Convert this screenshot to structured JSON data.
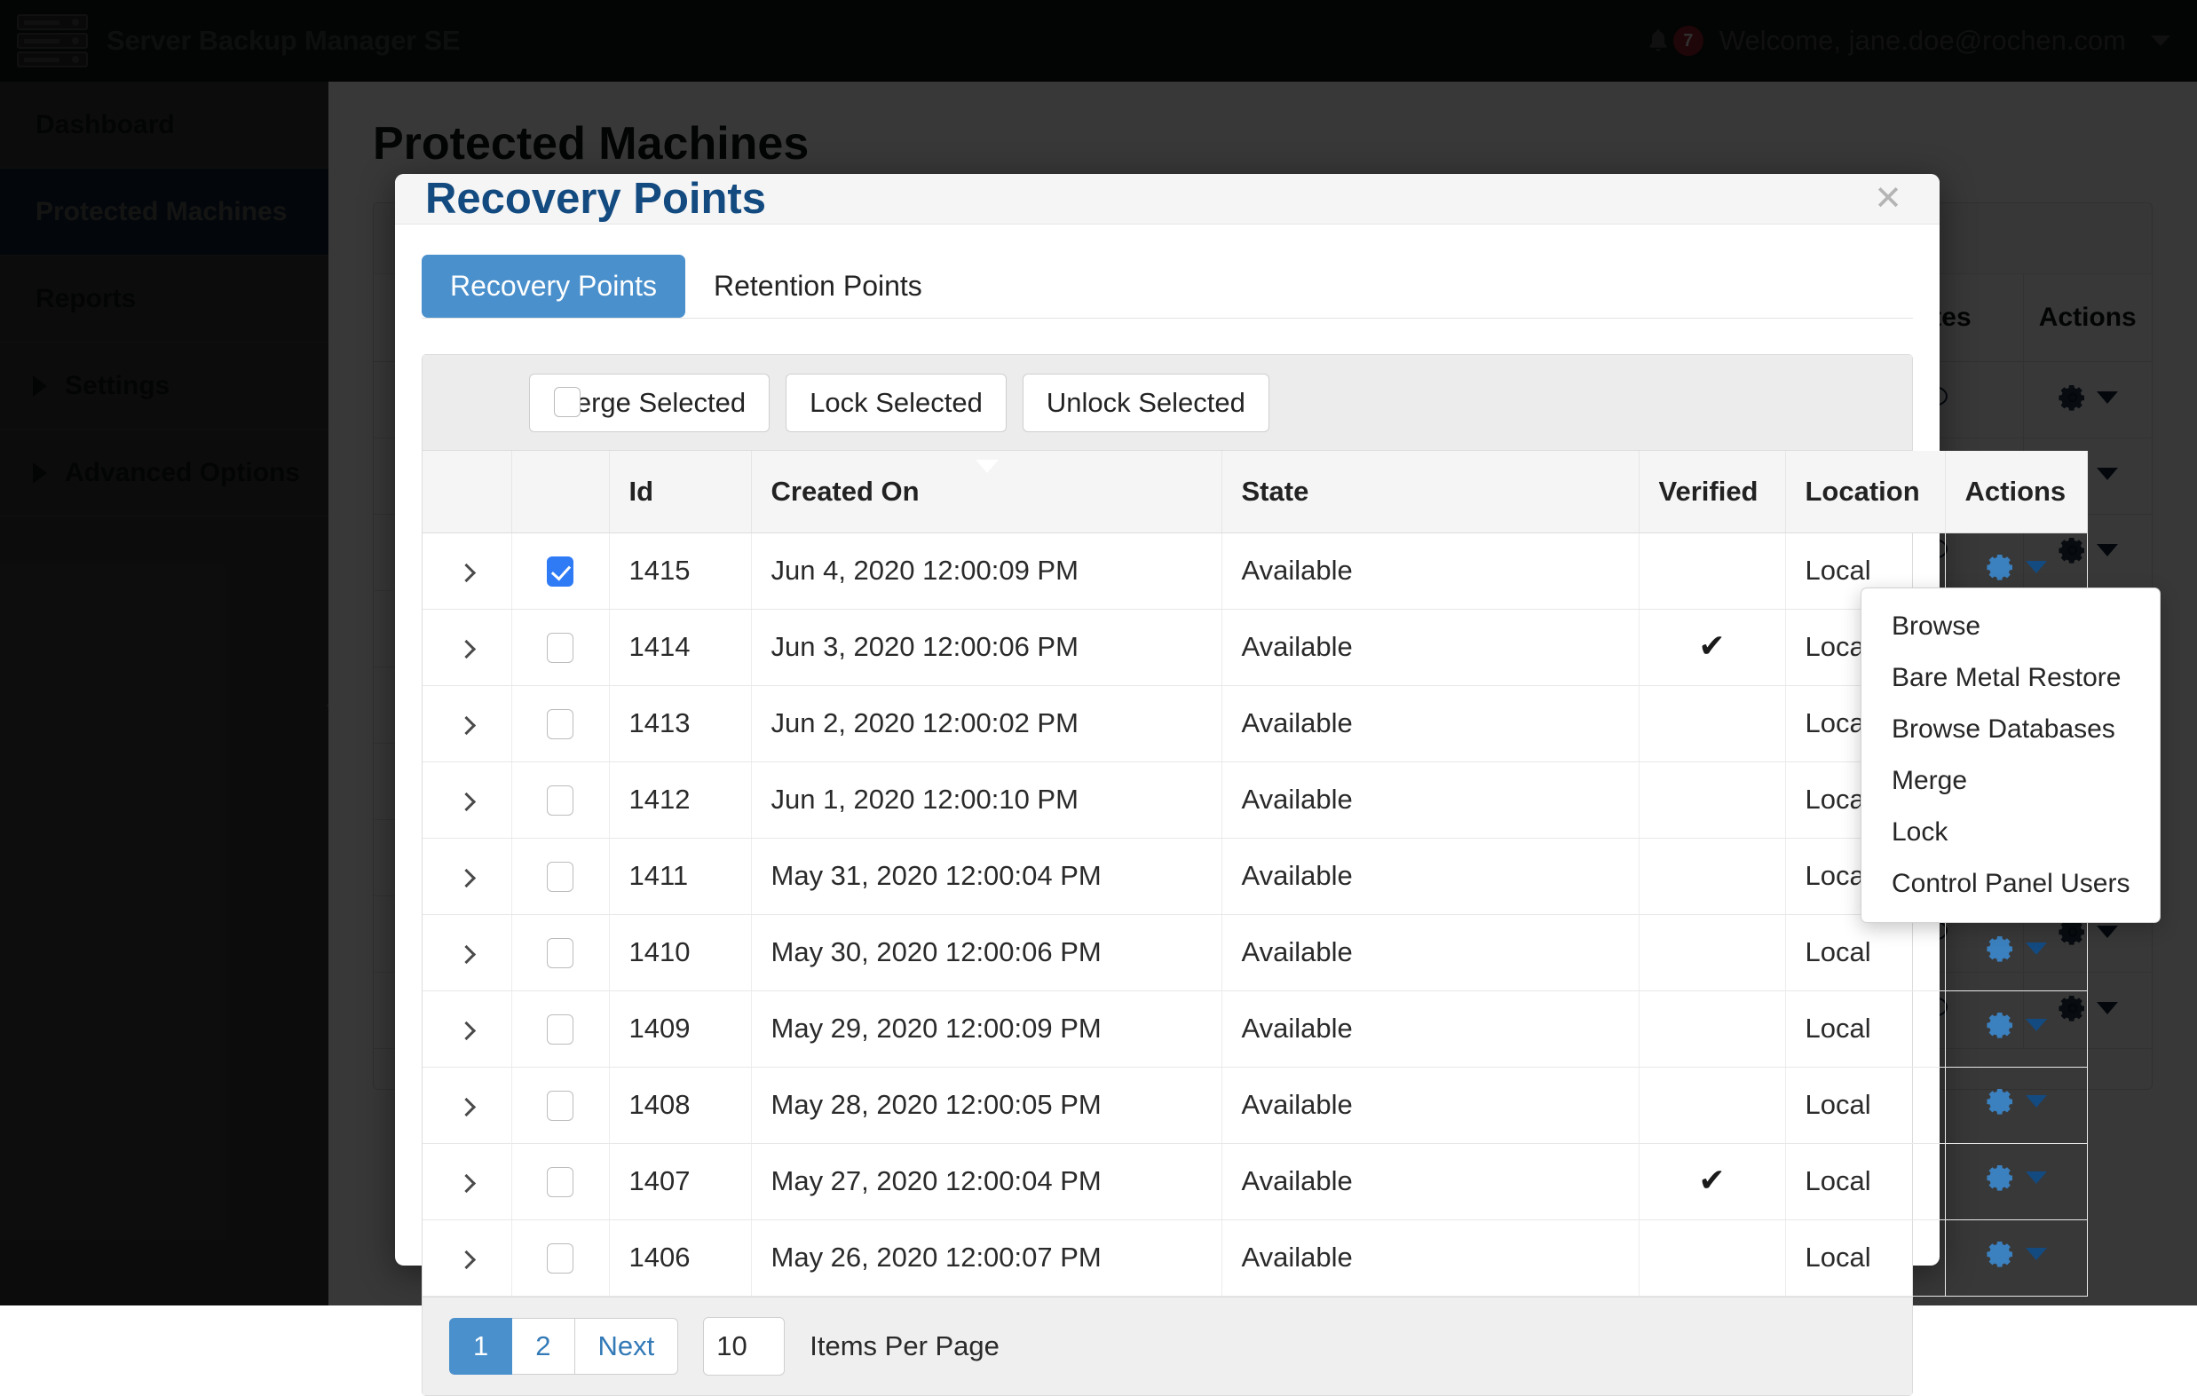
{
  "app": {
    "brand_title": "Server Backup Manager SE",
    "logo_icon": "server-stack-icon",
    "notifications": {
      "icon": "bell-icon",
      "count": "7"
    },
    "welcome": "Welcome, jane.doe@rochen.com",
    "user_caret_icon": "chevron-down-icon"
  },
  "sidebar": {
    "items": [
      {
        "label": "Dashboard",
        "expandable": false,
        "active": false
      },
      {
        "label": "Protected Machines",
        "expandable": false,
        "active": true
      },
      {
        "label": "Reports",
        "expandable": false,
        "active": false
      },
      {
        "label": "Settings",
        "expandable": true,
        "active": false
      },
      {
        "label": "Advanced Options",
        "expandable": true,
        "active": false
      }
    ],
    "collapse_handle_icon": "caret-left-icon"
  },
  "page": {
    "title": "Protected Machines",
    "background_table_headers": [
      "Notes",
      "Actions"
    ],
    "background_rows_icons": {
      "note": "speech-bubble-icon",
      "actions": "gear-icon"
    }
  },
  "modal": {
    "title": "Recovery Points",
    "close_icon": "close-icon",
    "tabs": [
      {
        "label": "Recovery Points",
        "active": true
      },
      {
        "label": "Retention Points",
        "active": false
      }
    ],
    "toolbar": {
      "select_all_checkbox": false,
      "buttons": [
        "Merge Selected",
        "Lock Selected",
        "Unlock Selected"
      ]
    },
    "table": {
      "columns": [
        "",
        "",
        "Id",
        "Created On",
        "State",
        "Verified",
        "Location",
        "Actions"
      ],
      "sorted_column": "Created On",
      "sort_direction": "desc",
      "rows": [
        {
          "expand": "chevron-right-icon",
          "selected": true,
          "id": "1415",
          "created_on": "Jun 4, 2020 12:00:09 PM",
          "state": "Available",
          "verified": "",
          "location": "Local",
          "actions_icon": "gear-icon"
        },
        {
          "expand": "chevron-right-icon",
          "selected": false,
          "id": "1414",
          "created_on": "Jun 3, 2020 12:00:06 PM",
          "state": "Available",
          "verified": "✔",
          "location": "Local",
          "actions_icon": "gear-icon"
        },
        {
          "expand": "chevron-right-icon",
          "selected": false,
          "id": "1413",
          "created_on": "Jun 2, 2020 12:00:02 PM",
          "state": "Available",
          "verified": "",
          "location": "Local",
          "actions_icon": "gear-icon"
        },
        {
          "expand": "chevron-right-icon",
          "selected": false,
          "id": "1412",
          "created_on": "Jun 1, 2020 12:00:10 PM",
          "state": "Available",
          "verified": "",
          "location": "Local",
          "actions_icon": "gear-icon"
        },
        {
          "expand": "chevron-right-icon",
          "selected": false,
          "id": "1411",
          "created_on": "May 31, 2020 12:00:04 PM",
          "state": "Available",
          "verified": "",
          "location": "Local",
          "actions_icon": "gear-icon"
        },
        {
          "expand": "chevron-right-icon",
          "selected": false,
          "id": "1410",
          "created_on": "May 30, 2020 12:00:06 PM",
          "state": "Available",
          "verified": "",
          "location": "Local",
          "actions_icon": "gear-icon"
        },
        {
          "expand": "chevron-right-icon",
          "selected": false,
          "id": "1409",
          "created_on": "May 29, 2020 12:00:09 PM",
          "state": "Available",
          "verified": "",
          "location": "Local",
          "actions_icon": "gear-icon"
        },
        {
          "expand": "chevron-right-icon",
          "selected": false,
          "id": "1408",
          "created_on": "May 28, 2020 12:00:05 PM",
          "state": "Available",
          "verified": "",
          "location": "Local",
          "actions_icon": "gear-icon"
        },
        {
          "expand": "chevron-right-icon",
          "selected": false,
          "id": "1407",
          "created_on": "May 27, 2020 12:00:04 PM",
          "state": "Available",
          "verified": "✔",
          "location": "Local",
          "actions_icon": "gear-icon"
        },
        {
          "expand": "chevron-right-icon",
          "selected": false,
          "id": "1406",
          "created_on": "May 26, 2020 12:00:07 PM",
          "state": "Available",
          "verified": "",
          "location": "Local",
          "actions_icon": "gear-icon"
        }
      ]
    },
    "pager": {
      "pages": [
        {
          "label": "1",
          "active": true
        },
        {
          "label": "2",
          "active": false
        },
        {
          "label": "Next",
          "active": false
        }
      ],
      "items_per_page_value": "10",
      "items_per_page_label": "Items Per Page"
    }
  },
  "actions_menu": {
    "items": [
      "Browse",
      "Bare Metal Restore",
      "Browse Databases",
      "Merge",
      "Lock",
      "Control Panel Users"
    ]
  },
  "colors": {
    "accent_blue": "#4a90cc",
    "link_blue": "#337ab7",
    "title_blue": "#134a80",
    "checkbox_blue": "#2f7bf6",
    "badge_red": "#8e1f24",
    "sidebar_active": "#0e2135"
  }
}
